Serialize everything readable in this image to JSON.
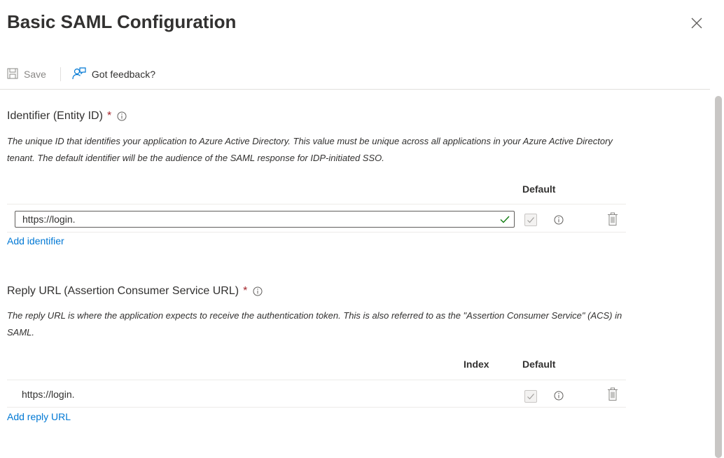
{
  "page": {
    "title": "Basic SAML Configuration"
  },
  "toolbar": {
    "save_label": "Save",
    "feedback_label": "Got feedback?"
  },
  "identifier": {
    "title": "Identifier (Entity ID)",
    "required_mark": "*",
    "description": "The unique ID that identifies your application to Azure Active Directory. This value must be unique across all applications in your Azure Active Directory tenant. The default identifier will be the audience of the SAML response for IDP-initiated SSO.",
    "column_default": "Default",
    "value": "https://login.",
    "add_link": "Add identifier"
  },
  "reply": {
    "title": "Reply URL (Assertion Consumer Service URL)",
    "required_mark": "*",
    "description": "The reply URL is where the application expects to receive the authentication token. This is also referred to as the \"Assertion Consumer Service\" (ACS) in SAML.",
    "column_index": "Index",
    "column_default": "Default",
    "value": "https://login.",
    "add_link": "Add reply URL"
  },
  "icons": {
    "close": "close-icon",
    "save": "save-icon",
    "feedback": "feedback-icon",
    "info": "info-icon",
    "check": "checkmark-icon",
    "trash": "trash-icon"
  },
  "colors": {
    "accent": "#0078d4",
    "required": "#a4262c",
    "valid": "#107c10",
    "text": "#323130"
  }
}
